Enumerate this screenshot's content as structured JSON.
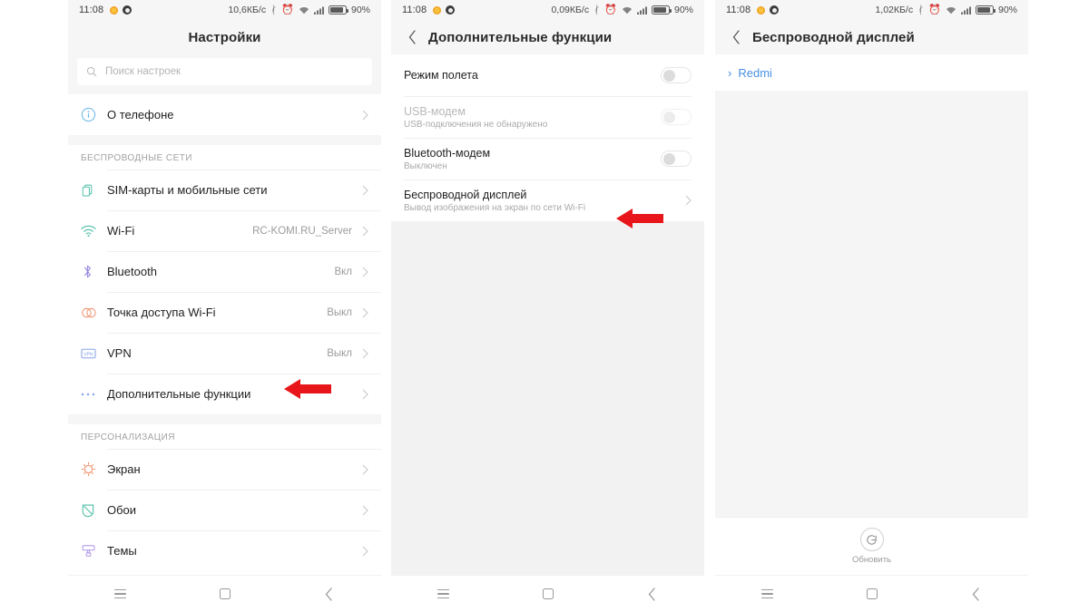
{
  "status_bar": {
    "time": "11:08",
    "battery_percent": "90%",
    "icons": [
      "weather-icon",
      "app-notification-icon",
      "bluetooth-icon",
      "alarm-icon",
      "wifi-icon",
      "signal-icon",
      "battery-icon"
    ],
    "speed_phone1": "10,6КБ/c",
    "speed_phone2": "0,09КБ/c",
    "speed_phone3": "1,02КБ/c"
  },
  "phone1": {
    "title": "Настройки",
    "search": {
      "placeholder": "Поиск настроек"
    },
    "about": {
      "label": "О телефоне",
      "icon": "info-icon"
    },
    "group_wireless": {
      "header": "БЕСПРОВОДНЫЕ СЕТИ",
      "items": [
        {
          "label": "SIM-карты и мобильные сети",
          "value": "",
          "icon": "sim-card-icon"
        },
        {
          "label": "Wi-Fi",
          "value": "RC-KOMI.RU_Server",
          "icon": "wifi-icon"
        },
        {
          "label": "Bluetooth",
          "value": "Вкл",
          "icon": "bluetooth-icon"
        },
        {
          "label": "Точка доступа Wi-Fi",
          "value": "Выкл",
          "icon": "hotspot-icon"
        },
        {
          "label": "VPN",
          "value": "Выкл",
          "icon": "vpn-icon"
        },
        {
          "label": "Дополнительные функции",
          "value": "",
          "icon": "more-dots-icon"
        }
      ]
    },
    "group_personalization": {
      "header": "ПЕРСОНАЛИЗАЦИЯ",
      "items": [
        {
          "label": "Экран",
          "value": "",
          "icon": "display-sun-icon"
        },
        {
          "label": "Обои",
          "value": "",
          "icon": "wallpaper-icon"
        },
        {
          "label": "Темы",
          "value": "",
          "icon": "themes-roller-icon"
        }
      ]
    }
  },
  "phone2": {
    "title": "Дополнительные функции",
    "rows": [
      {
        "label": "Режим полета",
        "sub": "",
        "control": "toggle-off",
        "dim": false
      },
      {
        "label": "USB-модем",
        "sub": "USB-подключения не обнаружено",
        "control": "toggle-off-disabled",
        "dim": true
      },
      {
        "label": "Bluetooth-модем",
        "sub": "Выключен",
        "control": "toggle-off",
        "dim": false
      },
      {
        "label": "Беспроводной дисплей",
        "sub": "Вывод изображения на экран по сети Wi-Fi",
        "control": "chevron",
        "dim": false
      }
    ]
  },
  "phone3": {
    "title": "Беспроводной дисплей",
    "device": {
      "name": "Redmi",
      "chevron": "›"
    },
    "refresh": {
      "label": "Обновить",
      "icon": "refresh-icon"
    }
  },
  "nav_bar": {
    "menu": "menu-icon",
    "home": "home-square-icon",
    "back": "back-chevron-icon"
  },
  "annotations": {
    "arrow1_target": "Дополнительные функции",
    "arrow2_target": "Беспроводной дисплей",
    "arrow_color": "#e8161b"
  }
}
